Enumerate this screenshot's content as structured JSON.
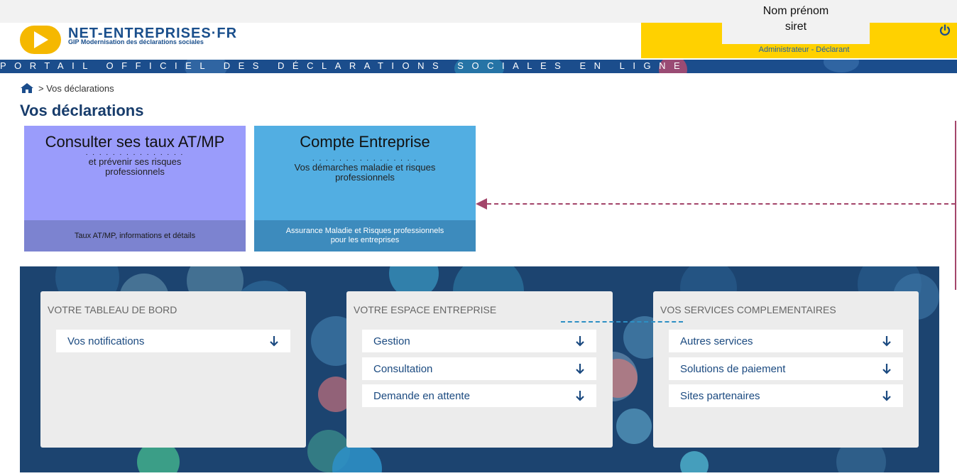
{
  "header": {
    "logo_title": "NET-ENTREPRISES·FR",
    "logo_subtitle": "GIP Modernisation des déclarations sociales",
    "user_name": "Nom prénom",
    "user_siret": "siret",
    "user_role": "Administrateur - Déclarant",
    "banner": "PORTAIL OFFICIEL DES DÉCLARATIONS SOCIALES EN LIGNE"
  },
  "breadcrumb": {
    "current": "> Vos déclarations"
  },
  "page_title": "Vos déclarations",
  "tiles": [
    {
      "title": "Consulter ses taux AT/MP",
      "dots": ". . . . . . . . . . . . . . .",
      "subtitle": "et prévenir ses risques professionnels",
      "footer": "Taux AT/MP, informations et détails"
    },
    {
      "title": "Compte Entreprise",
      "dots": ". . . . . . . . . . . . . . . .",
      "subtitle": "Vos démarches maladie et risques professionnels",
      "footer": "Assurance Maladie et Risques professionnels pour les entreprises"
    }
  ],
  "cards": [
    {
      "title": "VOTRE TABLEAU DE BORD",
      "items": [
        "Vos notifications"
      ]
    },
    {
      "title": "VOTRE ESPACE ENTREPRISE",
      "items": [
        "Gestion",
        "Consultation",
        "Demande en attente"
      ]
    },
    {
      "title": "VOS SERVICES COMPLEMENTAIRES",
      "items": [
        "Autres services",
        "Solutions de paiement",
        "Sites partenaires"
      ]
    }
  ],
  "colors": {
    "brand_blue": "#1b4d8c",
    "brand_yellow": "#ffd100",
    "tile_purple": "#9a9cfb",
    "tile_blue": "#52aee2",
    "annotation_magenta": "#a3456a",
    "annotation_blue": "#2d8fc4"
  },
  "icons": {
    "logo": "play-icon",
    "power": "power-icon",
    "home": "home-icon",
    "expand": "arrow-down-icon"
  }
}
